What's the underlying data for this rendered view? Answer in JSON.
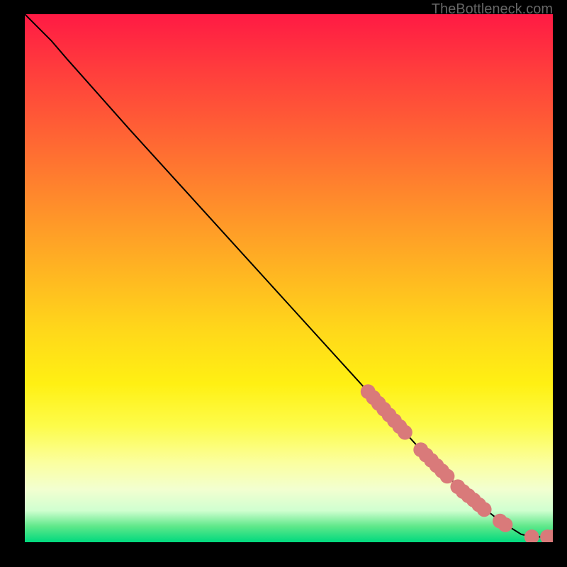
{
  "watermark": "TheBottleneck.com",
  "chart_data": {
    "type": "line",
    "title": "",
    "xlabel": "",
    "ylabel": "",
    "xlim": [
      0,
      100
    ],
    "ylim": [
      0,
      100
    ],
    "grid": false,
    "legend": false,
    "curve": {
      "points": [
        {
          "x": 0,
          "y": 100
        },
        {
          "x": 2,
          "y": 98
        },
        {
          "x": 5,
          "y": 95
        },
        {
          "x": 8,
          "y": 91.5
        },
        {
          "x": 12,
          "y": 87
        },
        {
          "x": 20,
          "y": 78
        },
        {
          "x": 30,
          "y": 67
        },
        {
          "x": 40,
          "y": 56
        },
        {
          "x": 50,
          "y": 45
        },
        {
          "x": 60,
          "y": 34
        },
        {
          "x": 65,
          "y": 28.5
        },
        {
          "x": 70,
          "y": 23
        },
        {
          "x": 75,
          "y": 17.5
        },
        {
          "x": 80,
          "y": 12.5
        },
        {
          "x": 85,
          "y": 8
        },
        {
          "x": 90,
          "y": 4
        },
        {
          "x": 94,
          "y": 1.5
        },
        {
          "x": 96,
          "y": 1
        },
        {
          "x": 98,
          "y": 1
        },
        {
          "x": 100,
          "y": 1
        }
      ]
    },
    "markers": {
      "color": "#d97a7a",
      "radius": 1.4,
      "points": [
        {
          "x": 65,
          "y": 28.5
        },
        {
          "x": 66,
          "y": 27.4
        },
        {
          "x": 67,
          "y": 26.3
        },
        {
          "x": 68,
          "y": 25.2
        },
        {
          "x": 69,
          "y": 24.1
        },
        {
          "x": 70,
          "y": 23.0
        },
        {
          "x": 71,
          "y": 21.9
        },
        {
          "x": 72,
          "y": 20.8
        },
        {
          "x": 75,
          "y": 17.5
        },
        {
          "x": 76,
          "y": 16.5
        },
        {
          "x": 77,
          "y": 15.5
        },
        {
          "x": 78,
          "y": 14.5
        },
        {
          "x": 79,
          "y": 13.5
        },
        {
          "x": 80,
          "y": 12.5
        },
        {
          "x": 82,
          "y": 10.5
        },
        {
          "x": 83,
          "y": 9.6
        },
        {
          "x": 84,
          "y": 8.8
        },
        {
          "x": 85,
          "y": 8.0
        },
        {
          "x": 86,
          "y": 7.1
        },
        {
          "x": 87,
          "y": 6.2
        },
        {
          "x": 90,
          "y": 4.0
        },
        {
          "x": 91,
          "y": 3.3
        },
        {
          "x": 96,
          "y": 1.0
        },
        {
          "x": 99,
          "y": 1.0
        },
        {
          "x": 100,
          "y": 1.0
        }
      ]
    }
  }
}
